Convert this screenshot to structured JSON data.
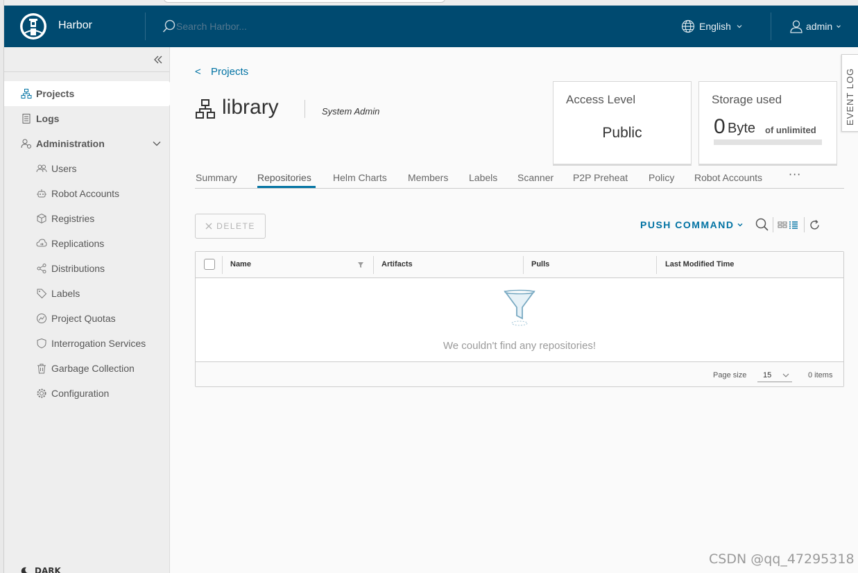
{
  "header": {
    "brand": "Harbor",
    "search_placeholder": "Search Harbor...",
    "language": "English",
    "user": "admin"
  },
  "sidebar": {
    "items": [
      {
        "label": "Projects",
        "icon": "projects-icon",
        "active": true
      },
      {
        "label": "Logs",
        "icon": "logs-icon"
      },
      {
        "label": "Administration",
        "icon": "administration-icon",
        "expanded": true
      },
      {
        "label": "Users",
        "icon": "users-icon"
      },
      {
        "label": "Robot Accounts",
        "icon": "robot-icon"
      },
      {
        "label": "Registries",
        "icon": "registries-icon"
      },
      {
        "label": "Replications",
        "icon": "replications-icon"
      },
      {
        "label": "Distributions",
        "icon": "distributions-icon"
      },
      {
        "label": "Labels",
        "icon": "tag-icon"
      },
      {
        "label": "Project Quotas",
        "icon": "quota-icon"
      },
      {
        "label": "Interrogation Services",
        "icon": "shield-icon"
      },
      {
        "label": "Garbage Collection",
        "icon": "trash-icon"
      },
      {
        "label": "Configuration",
        "icon": "gear-icon"
      }
    ],
    "theme_label": "DARK"
  },
  "breadcrumb": {
    "arrow": "<",
    "label": "Projects"
  },
  "project": {
    "name": "library",
    "role": "System Admin"
  },
  "access_card": {
    "label": "Access Level",
    "value": "Public"
  },
  "storage_card": {
    "label": "Storage used",
    "amount": "0",
    "unit": "Byte",
    "limit": "of unlimited",
    "used_fraction": 0
  },
  "event_log": "EVENT LOG",
  "tabs": [
    {
      "label": "Summary"
    },
    {
      "label": "Repositories",
      "active": true
    },
    {
      "label": "Helm Charts"
    },
    {
      "label": "Members"
    },
    {
      "label": "Labels"
    },
    {
      "label": "Scanner"
    },
    {
      "label": "P2P Preheat"
    },
    {
      "label": "Policy"
    },
    {
      "label": "Robot Accounts"
    }
  ],
  "tabs_more": "···",
  "toolbar": {
    "delete_label": "DELETE",
    "push_command": "PUSH COMMAND"
  },
  "grid": {
    "columns": [
      "Name",
      "Artifacts",
      "Pulls",
      "Last Modified Time"
    ],
    "rows": [],
    "empty_message": "We couldn't find any repositories!",
    "page_size_label": "Page size",
    "page_size": "15",
    "item_count": "0 items"
  },
  "watermark": "CSDN @qq_47295318",
  "colors": {
    "header_bg": "#004a70",
    "accent": "#0072a3",
    "sidebar_bg": "#eeeeee"
  }
}
